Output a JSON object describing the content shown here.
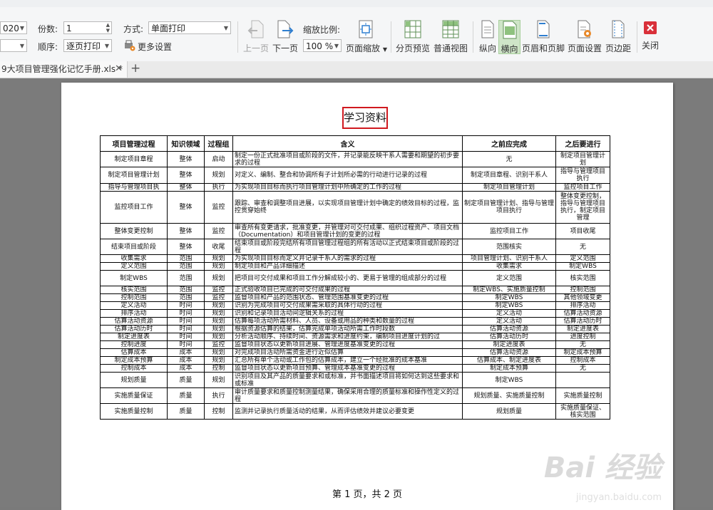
{
  "toolbar": {
    "year_value": "020",
    "copies_label": "份数:",
    "copies_value": "1",
    "method_label": "方式:",
    "method_value": "单面打印",
    "order_label": "顺序:",
    "order_value": "逐页打印",
    "more_settings": "更多设置",
    "prev_page": "上一页",
    "next_page": "下一页",
    "zoom_label": "缩放比例:",
    "zoom_value": "100 %",
    "page_zoom": "页面缩放",
    "page_preview": "分页预览",
    "normal_view": "普通视图",
    "portrait": "纵向",
    "landscape": "横向",
    "header_footer": "页眉和页脚",
    "page_setup": "页面设置",
    "margins": "页边距",
    "close": "关闭"
  },
  "tabs": {
    "file_name": "9大项目管理强化记忆手册.xls *",
    "close_glyph": "✕",
    "add_glyph": "+"
  },
  "document": {
    "title": "学习资料",
    "headers": [
      "项目管理过程",
      "知识领域",
      "过程组",
      "含义",
      "之前应完成",
      "之后要进行"
    ],
    "rows": [
      [
        "制定项目章程",
        "整体",
        "启动",
        "制定一份正式批准项目或阶段的文件，并记录能反映干系人需要和期望的初步要求的过程",
        "无",
        "制定项目管理计划"
      ],
      [
        "制定项目管理计划",
        "整体",
        "规划",
        "对定义、编制、整合和协调所有子计划所必需的行动进行记录的过程",
        "制定项目章程、识别干系人",
        "指导与管理项目执行"
      ],
      [
        "指导与管理项目执",
        "整体",
        "执行",
        "为实现项目目标而执行项目管理计划中所确定的工作的过程",
        "制定项目管理计划",
        "监控项目工作"
      ],
      [
        "监控项目工作",
        "整体",
        "监控",
        "跟踪、审查和调整项目进展，以实现项目管理计划中确定的绩效目标的过程，监控贯穿始终",
        "制定项目管理计划、指导与管理项目执行",
        "整体变更控制，指导与管理项目执行，制定项目管理"
      ],
      [
        "整体变更控制",
        "整体",
        "监控",
        "审查所有变更请求，批准变更，并管理对可交付成果、组织过程资产、项目文档（Documentation）和项目管理计划的变更的过程",
        "监控项目工作",
        "项目收尾"
      ],
      [
        "结束项目或阶段",
        "整体",
        "收尾",
        "结束项目或阶段完结所有项目管理过程组的所有活动以正式结束项目或阶段的过程",
        "范围核实",
        "无"
      ],
      [
        "收集需求",
        "范围",
        "规划",
        "为实现项目目标而定义并记录干系人的需求的过程",
        "项目管理计划、识别干系人",
        "定义范围"
      ],
      [
        "定义范围",
        "范围",
        "规划",
        "制定项目和产品详细描述",
        "收集需求",
        "制定WBS"
      ],
      [
        "制定WBS",
        "范围",
        "规划",
        "把项目可交付成果和项目工作分解成较小的、更易于管理的组成部分的过程",
        "定义范围",
        "核实范围"
      ],
      [
        "核实范围",
        "范围",
        "监控",
        "正式验收项目已完成的可交付成果的过程",
        "制定WBS、实施质量控制",
        "控制范围"
      ],
      [
        "控制范围",
        "范围",
        "监控",
        "监督项目和产品的范围状态、管理范围基准变更的过程",
        "制定WBS",
        "其他领域变更"
      ],
      [
        "定义活动",
        "时间",
        "规划",
        "识别为完成项目可交付成果需采取的具体行动的过程",
        "制定WBS",
        "排序活动"
      ],
      [
        "排序活动",
        "时间",
        "规划",
        "识别和记录项目活动间逻辑关系的过程",
        "定义活动",
        "估算活动资源"
      ],
      [
        "估算活动资源",
        "时间",
        "规划",
        "估算每项活动所需材料、人员、设备或用品的种类和数量的过程",
        "定义活动",
        "估算活动历时"
      ],
      [
        "估算活动历时",
        "时间",
        "规划",
        "根据资源估算的结果，估算完成单项活动所需工作时段数",
        "估算活动资源",
        "制定进度表"
      ],
      [
        "制定进度表",
        "时间",
        "规划",
        "分析活动顺序、持续时间、资源需求和进度约束，编制项目进度计划的过",
        "估算活动历时",
        "进度控制"
      ],
      [
        "控制进度",
        "时间",
        "监控",
        "监督项目状态以更新项目进展、管理进度基准变更的过程",
        "制定进度表",
        "无"
      ],
      [
        "估算成本",
        "成本",
        "规划",
        "对完成项目活动所需资金进行近似估算",
        "估算活动资源",
        "制定成本预算"
      ],
      [
        "制定成本预算",
        "成本",
        "规划",
        "汇总所有单个活动或工作包的估算成本，建立一个经批准的成本基准",
        "估算成本、制定进度表",
        "控制成本"
      ],
      [
        "控制成本",
        "成本",
        "控制",
        "监督项目状态以更新项目预算、管理成本基准变更的过程",
        "制定成本预算",
        "无"
      ],
      [
        "规划质量",
        "质量",
        "规划",
        "识别项目及其产品的质量要求和或标准，并书面描述项目将如何达到这些要求和或标准",
        "制定WBS",
        ""
      ],
      [
        "实施质量保证",
        "质量",
        "执行",
        "审计质量要求和质量控制测量结果，确保采用合理的质量标准和操作性定义的过程",
        "规划质量、实施质量控制",
        "实施质量控制"
      ],
      [
        "实施质量控制",
        "质量",
        "控制",
        "监测并记录执行质量活动的结果，从而评估绩效并建议必要变更",
        "规划质量",
        "实施质量保证、核实范围"
      ]
    ],
    "row_heights": [],
    "pager": "第 1 页，共 2 页"
  },
  "watermark": {
    "text": "Bai 经验",
    "url": "jingyan.baidu.com"
  }
}
